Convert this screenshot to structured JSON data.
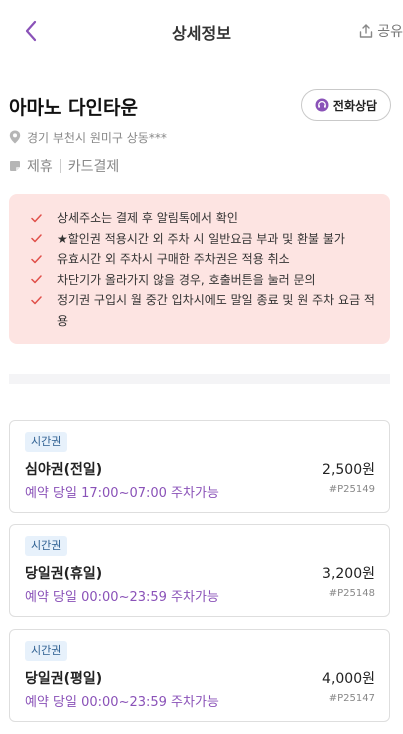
{
  "header": {
    "title": "상세정보",
    "share_label": "공유"
  },
  "place": {
    "name": "아마노 다인타운",
    "call_label": "전화상담",
    "address": "경기 부천시 원미구 상동***",
    "tags": [
      "제휴",
      "카드결제"
    ]
  },
  "notice": {
    "items": [
      "상세주소는 결제 후 알림톡에서 확인",
      "★할인권 적용시간 외 주차 시 일반요금 부과 및 환불 불가",
      "유효시간 외 주차시 구매한 주차권은 적용 취소",
      "차단기가 올라가지 않을 경우, 호출버튼을 눌러 문의",
      "정기권 구입시 월 중간 입차시에도 말일 종료 및 원 주차 요금 적용"
    ]
  },
  "tickets": [
    {
      "badge": "시간권",
      "name": "심야권(전일)",
      "price": "2,500원",
      "availability": "예약 당일 17:00~07:00 주차가능",
      "code": "#P25149"
    },
    {
      "badge": "시간권",
      "name": "당일권(휴일)",
      "price": "3,200원",
      "availability": "예약 당일 00:00~23:59 주차가능",
      "code": "#P25148"
    },
    {
      "badge": "시간권",
      "name": "당일권(평일)",
      "price": "4,000원",
      "availability": "예약 당일 00:00~23:59 주차가능",
      "code": "#P25147"
    }
  ],
  "colors": {
    "accent_purple": "#8a52b8",
    "notice_bg": "#fde4e2",
    "notice_check": "#e0504a",
    "badge_bg": "#e7f1fb"
  },
  "icons": {
    "back": "chevron-left-icon",
    "share": "share-upload-icon",
    "call": "headset-icon",
    "location": "location-pin-icon",
    "tag": "ticket-tag-icon",
    "check": "check-icon"
  }
}
